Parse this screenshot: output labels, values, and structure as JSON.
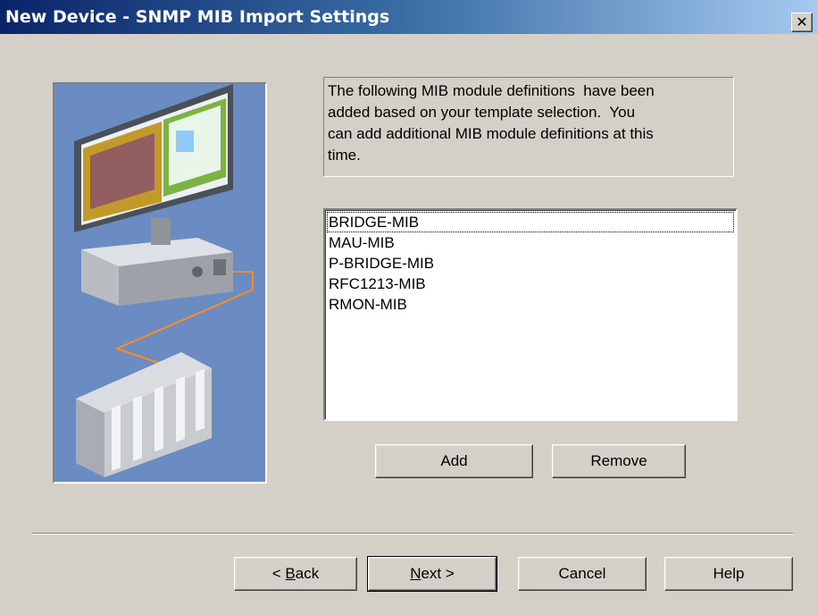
{
  "window": {
    "title": "New Device - SNMP MIB Import Settings",
    "close_glyph": "✕"
  },
  "info_text": "The following MIB module definitions  have been\nadded based on your template selection.  You\ncan add additional MIB module definitions at this\ntime.",
  "mib_list": {
    "items": [
      "BRIDGE-MIB",
      "MAU-MIB",
      "P-BRIDGE-MIB",
      "RFC1213-MIB",
      "RMON-MIB"
    ]
  },
  "list_buttons": {
    "add": "Add",
    "remove": "Remove"
  },
  "wizard_buttons": {
    "back_prefix": "< ",
    "back_key": "B",
    "back_rest": "ack",
    "next_key": "N",
    "next_rest": "ext >",
    "cancel": "Cancel",
    "help": "Help"
  },
  "colors": {
    "dialog_bg": "#d4d0c8",
    "title_start": "#0a246a",
    "title_end": "#a6caf0",
    "graphic_bg": "#6b8cc3"
  }
}
